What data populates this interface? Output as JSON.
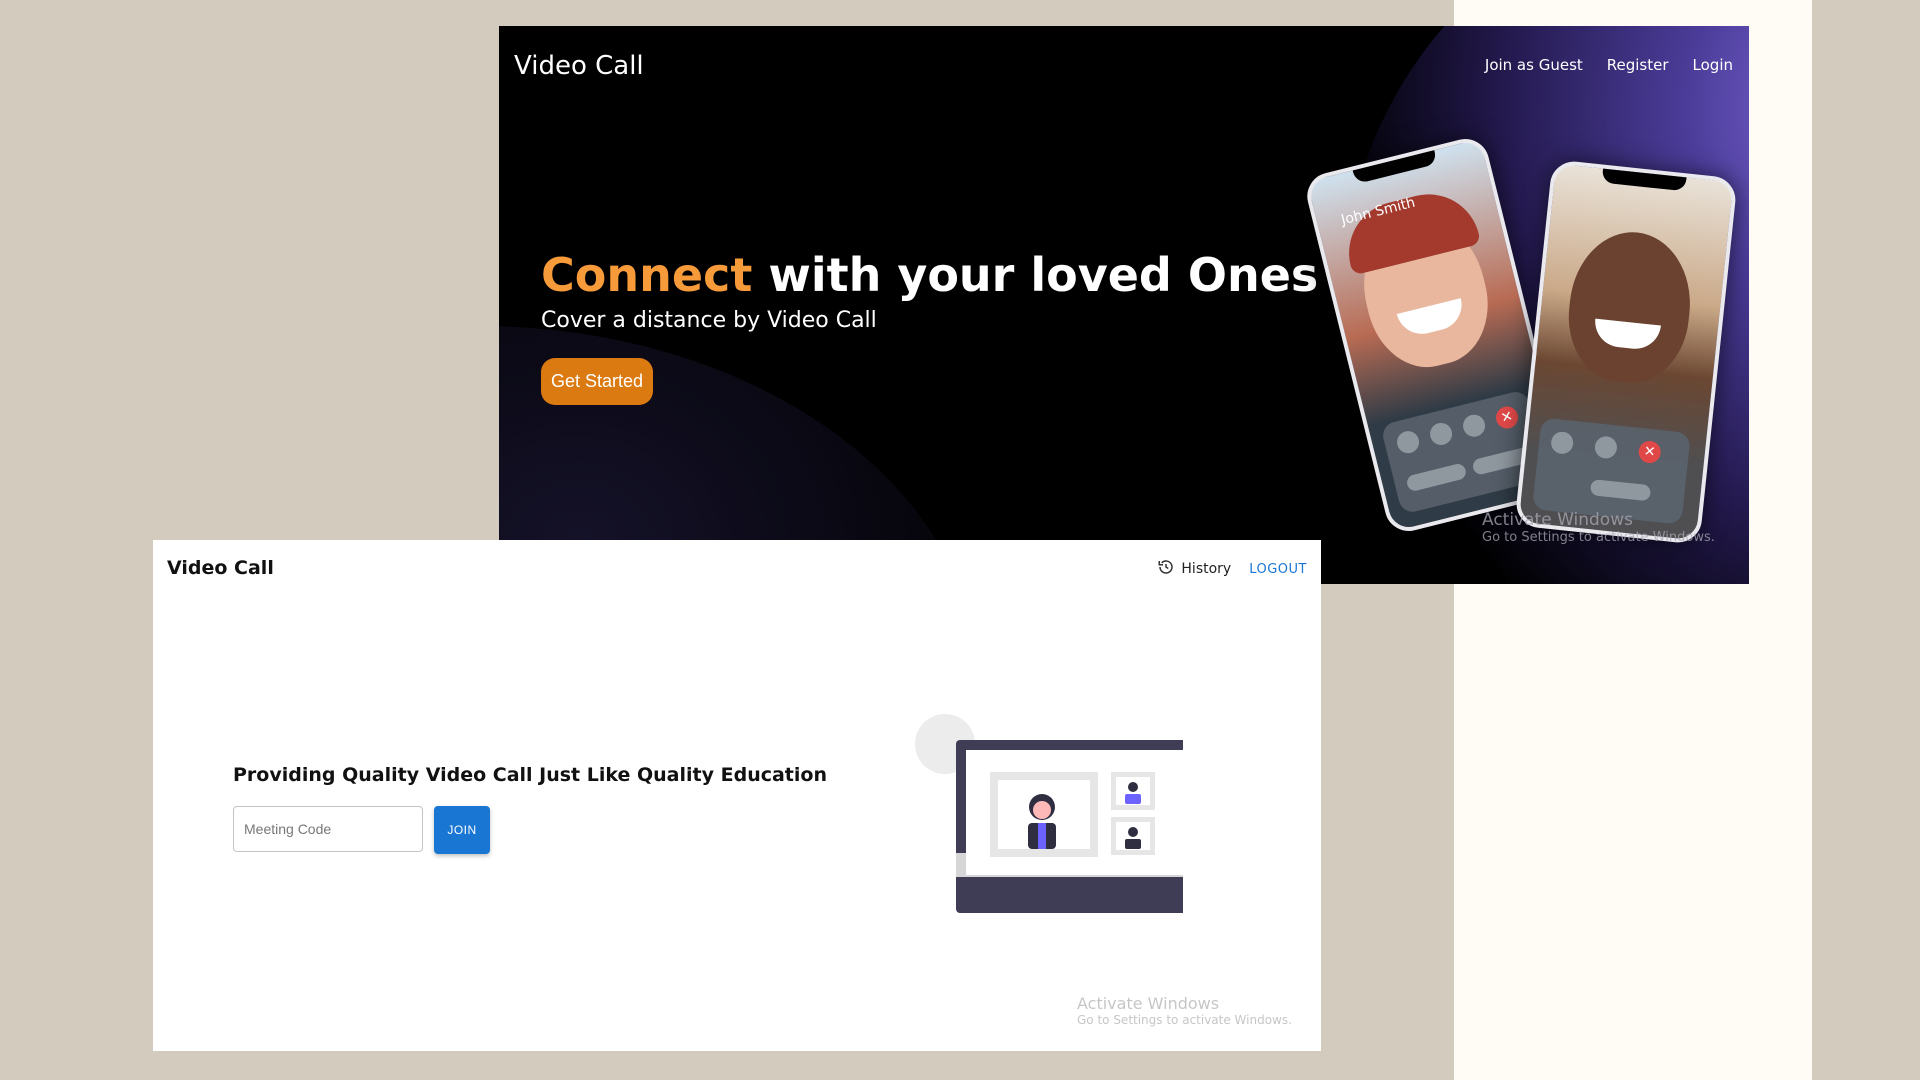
{
  "landing": {
    "brand": "Video Call",
    "nav": [
      "Join as Guest",
      "Register",
      "Login"
    ],
    "hero": {
      "title_accent": "Connect",
      "title_rest": "with your loved Ones",
      "subtitle": "Cover a distance by Video Call",
      "cta": "Get Started"
    },
    "phone_caller_name": "John Smith",
    "watermark": {
      "title": "Activate Windows",
      "subtitle": "Go to Settings to activate Windows."
    }
  },
  "dashboard": {
    "brand": "Video Call",
    "nav": {
      "history": "History",
      "logout": "LOGOUT"
    },
    "heading": "Providing Quality Video Call Just Like Quality Education",
    "meeting_input": {
      "placeholder": "Meeting Code",
      "value": ""
    },
    "join": "JOIN",
    "watermark": {
      "title": "Activate Windows",
      "subtitle": "Go to Settings to activate Windows."
    }
  },
  "colors": {
    "accent_orange": "#f79a3a",
    "cta_orange": "#dc7a12",
    "primary_blue": "#1976d2",
    "illustration_purple": "#6c63ff",
    "monitor_frame": "#3f3d56"
  },
  "icons": {
    "history": "history-clock-icon"
  }
}
